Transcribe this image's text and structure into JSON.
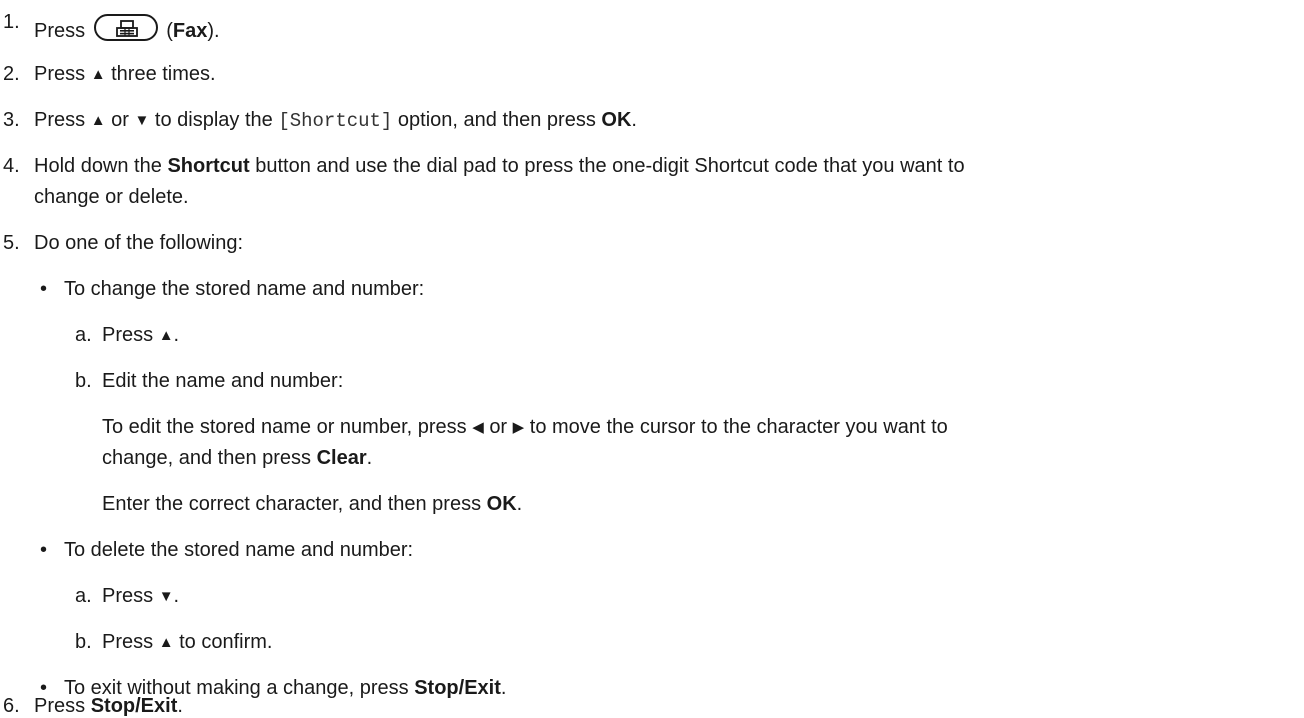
{
  "steps": {
    "s1": {
      "num": "1.",
      "press": "Press",
      "open": "(",
      "fax": "Fax",
      "close": ")."
    },
    "s2": {
      "num": "2.",
      "press": "Press",
      "tail": "three times."
    },
    "s3": {
      "num": "3.",
      "press": "Press",
      "or": "or",
      "mid": "to display the",
      "option": "[Shortcut]",
      "then": "option, and then press",
      "ok": "OK",
      "end": "."
    },
    "s4": {
      "num": "4.",
      "a": "Hold down the",
      "shortcut": "Shortcut",
      "b": "button and use the dial pad to press the one-digit Shortcut code that you want to",
      "line2": "change or delete."
    },
    "s5": {
      "num": "5.",
      "text": "Do one of the following:"
    },
    "s6": {
      "num": "6.",
      "press": "Press",
      "stop": "Stop/Exit",
      "end": "."
    }
  },
  "options": {
    "change": {
      "bullet": "•",
      "text": "To change the stored name and number:",
      "a": {
        "label": "a.",
        "press": "Press",
        "end": "."
      },
      "b": {
        "label": "b.",
        "text": "Edit the name and number:"
      },
      "p1": {
        "a": "To edit the stored name or number, press",
        "or": "or",
        "b": "to move the cursor to the character you want to",
        "line2a": "change, and then press",
        "clear": "Clear",
        "end": "."
      },
      "p2": {
        "a": "Enter the correct character, and then press",
        "ok": "OK",
        "end": "."
      }
    },
    "delete": {
      "bullet": "•",
      "text": "To delete the stored name and number:",
      "a": {
        "label": "a.",
        "press": "Press",
        "end": "."
      },
      "b": {
        "label": "b.",
        "press": "Press",
        "tail": "to confirm."
      }
    },
    "exit": {
      "bullet": "•",
      "a": "To exit without making a change, press",
      "stop": "Stop/Exit",
      "end": "."
    }
  },
  "glyphs": {
    "up": "▲",
    "down": "▼",
    "left": "◀",
    "right": "▶"
  }
}
